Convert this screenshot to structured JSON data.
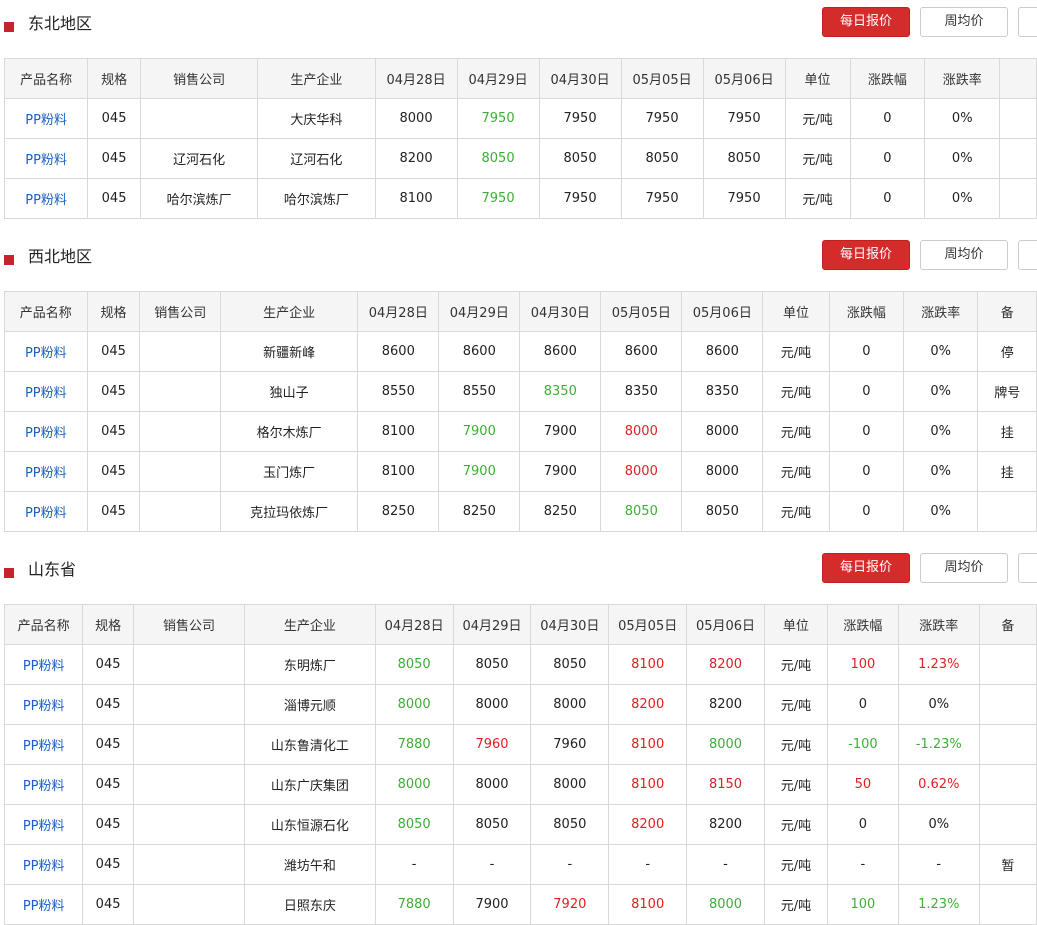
{
  "buttons": {
    "daily": "每日报价",
    "weekly": "周均价"
  },
  "sections": [
    {
      "title": "东北地区",
      "headers": [
        "产品名称",
        "规格",
        "销售公司",
        "生产企业",
        "04月28日",
        "04月29日",
        "04月30日",
        "05月05日",
        "05月06日",
        "单位",
        "涨跌幅",
        "涨跌率",
        ""
      ],
      "rows": [
        {
          "product": "PP粉料",
          "spec": "045",
          "seller": "",
          "producer": "大庆华科",
          "p": [
            "8000",
            "7950",
            "7950",
            "7950",
            "7950"
          ],
          "pc": [
            "black",
            "green",
            "black",
            "black",
            "black"
          ],
          "unit": "元/吨",
          "chg": "0",
          "rate": "0%",
          "cc": "black",
          "note": ""
        },
        {
          "product": "PP粉料",
          "spec": "045",
          "seller": "辽河石化",
          "producer": "辽河石化",
          "p": [
            "8200",
            "8050",
            "8050",
            "8050",
            "8050"
          ],
          "pc": [
            "black",
            "green",
            "black",
            "black",
            "black"
          ],
          "unit": "元/吨",
          "chg": "0",
          "rate": "0%",
          "cc": "black",
          "note": ""
        },
        {
          "product": "PP粉料",
          "spec": "045",
          "seller": "哈尔滨炼厂",
          "producer": "哈尔滨炼厂",
          "p": [
            "8100",
            "7950",
            "7950",
            "7950",
            "7950"
          ],
          "pc": [
            "black",
            "green",
            "black",
            "black",
            "black"
          ],
          "unit": "元/吨",
          "chg": "0",
          "rate": "0%",
          "cc": "black",
          "note": ""
        }
      ]
    },
    {
      "title": "西北地区",
      "headers": [
        "产品名称",
        "规格",
        "销售公司",
        "生产企业",
        "04月28日",
        "04月29日",
        "04月30日",
        "05月05日",
        "05月06日",
        "单位",
        "涨跌幅",
        "涨跌率",
        "备"
      ],
      "rows": [
        {
          "product": "PP粉料",
          "spec": "045",
          "seller": "",
          "producer": "新疆新峰",
          "p": [
            "8600",
            "8600",
            "8600",
            "8600",
            "8600"
          ],
          "pc": [
            "black",
            "black",
            "black",
            "black",
            "black"
          ],
          "unit": "元/吨",
          "chg": "0",
          "rate": "0%",
          "cc": "black",
          "note": "停"
        },
        {
          "product": "PP粉料",
          "spec": "045",
          "seller": "",
          "producer": "独山子",
          "p": [
            "8550",
            "8550",
            "8350",
            "8350",
            "8350"
          ],
          "pc": [
            "black",
            "black",
            "green",
            "black",
            "black"
          ],
          "unit": "元/吨",
          "chg": "0",
          "rate": "0%",
          "cc": "black",
          "note": "牌号"
        },
        {
          "product": "PP粉料",
          "spec": "045",
          "seller": "",
          "producer": "格尔木炼厂",
          "p": [
            "8100",
            "7900",
            "7900",
            "8000",
            "8000"
          ],
          "pc": [
            "black",
            "green",
            "black",
            "red",
            "black"
          ],
          "unit": "元/吨",
          "chg": "0",
          "rate": "0%",
          "cc": "black",
          "note": "挂"
        },
        {
          "product": "PP粉料",
          "spec": "045",
          "seller": "",
          "producer": "玉门炼厂",
          "p": [
            "8100",
            "7900",
            "7900",
            "8000",
            "8000"
          ],
          "pc": [
            "black",
            "green",
            "black",
            "red",
            "black"
          ],
          "unit": "元/吨",
          "chg": "0",
          "rate": "0%",
          "cc": "black",
          "note": "挂"
        },
        {
          "product": "PP粉料",
          "spec": "045",
          "seller": "",
          "producer": "克拉玛依炼厂",
          "p": [
            "8250",
            "8250",
            "8250",
            "8050",
            "8050"
          ],
          "pc": [
            "black",
            "black",
            "black",
            "green",
            "black"
          ],
          "unit": "元/吨",
          "chg": "0",
          "rate": "0%",
          "cc": "black",
          "note": ""
        }
      ]
    },
    {
      "title": "山东省",
      "headers": [
        "产品名称",
        "规格",
        "销售公司",
        "生产企业",
        "04月28日",
        "04月29日",
        "04月30日",
        "05月05日",
        "05月06日",
        "单位",
        "涨跌幅",
        "涨跌率",
        "备"
      ],
      "rows": [
        {
          "product": "PP粉料",
          "spec": "045",
          "seller": "",
          "producer": "东明炼厂",
          "p": [
            "8050",
            "8050",
            "8050",
            "8100",
            "8200"
          ],
          "pc": [
            "green",
            "black",
            "black",
            "red",
            "red"
          ],
          "unit": "元/吨",
          "chg": "100",
          "rate": "1.23%",
          "cc": "red",
          "note": ""
        },
        {
          "product": "PP粉料",
          "spec": "045",
          "seller": "",
          "producer": "淄博元顺",
          "p": [
            "8000",
            "8000",
            "8000",
            "8200",
            "8200"
          ],
          "pc": [
            "green",
            "black",
            "black",
            "red",
            "black"
          ],
          "unit": "元/吨",
          "chg": "0",
          "rate": "0%",
          "cc": "black",
          "note": ""
        },
        {
          "product": "PP粉料",
          "spec": "045",
          "seller": "",
          "producer": "山东鲁清化工",
          "p": [
            "7880",
            "7960",
            "7960",
            "8100",
            "8000"
          ],
          "pc": [
            "green",
            "red",
            "black",
            "red",
            "green"
          ],
          "unit": "元/吨",
          "chg": "-100",
          "rate": "-1.23%",
          "cc": "green",
          "note": ""
        },
        {
          "product": "PP粉料",
          "spec": "045",
          "seller": "",
          "producer": "山东广庆集团",
          "p": [
            "8000",
            "8000",
            "8000",
            "8100",
            "8150"
          ],
          "pc": [
            "green",
            "black",
            "black",
            "red",
            "red"
          ],
          "unit": "元/吨",
          "chg": "50",
          "rate": "0.62%",
          "cc": "red",
          "note": ""
        },
        {
          "product": "PP粉料",
          "spec": "045",
          "seller": "",
          "producer": "山东恒源石化",
          "p": [
            "8050",
            "8050",
            "8050",
            "8200",
            "8200"
          ],
          "pc": [
            "green",
            "black",
            "black",
            "red",
            "black"
          ],
          "unit": "元/吨",
          "chg": "0",
          "rate": "0%",
          "cc": "black",
          "note": ""
        },
        {
          "product": "PP粉料",
          "spec": "045",
          "seller": "",
          "producer": "潍坊午和",
          "p": [
            "-",
            "-",
            "-",
            "-",
            "-"
          ],
          "pc": [
            "black",
            "black",
            "black",
            "black",
            "black"
          ],
          "unit": "元/吨",
          "chg": "-",
          "rate": "-",
          "cc": "black",
          "note": "暂"
        },
        {
          "product": "PP粉料",
          "spec": "045",
          "seller": "",
          "producer": "日照东庆",
          "p": [
            "7880",
            "7900",
            "7920",
            "8100",
            "8000"
          ],
          "pc": [
            "green",
            "black",
            "red",
            "red",
            "green"
          ],
          "unit": "元/吨",
          "chg": "100",
          "rate": "1.23%",
          "cc": "green",
          "note": ""
        }
      ]
    }
  ]
}
